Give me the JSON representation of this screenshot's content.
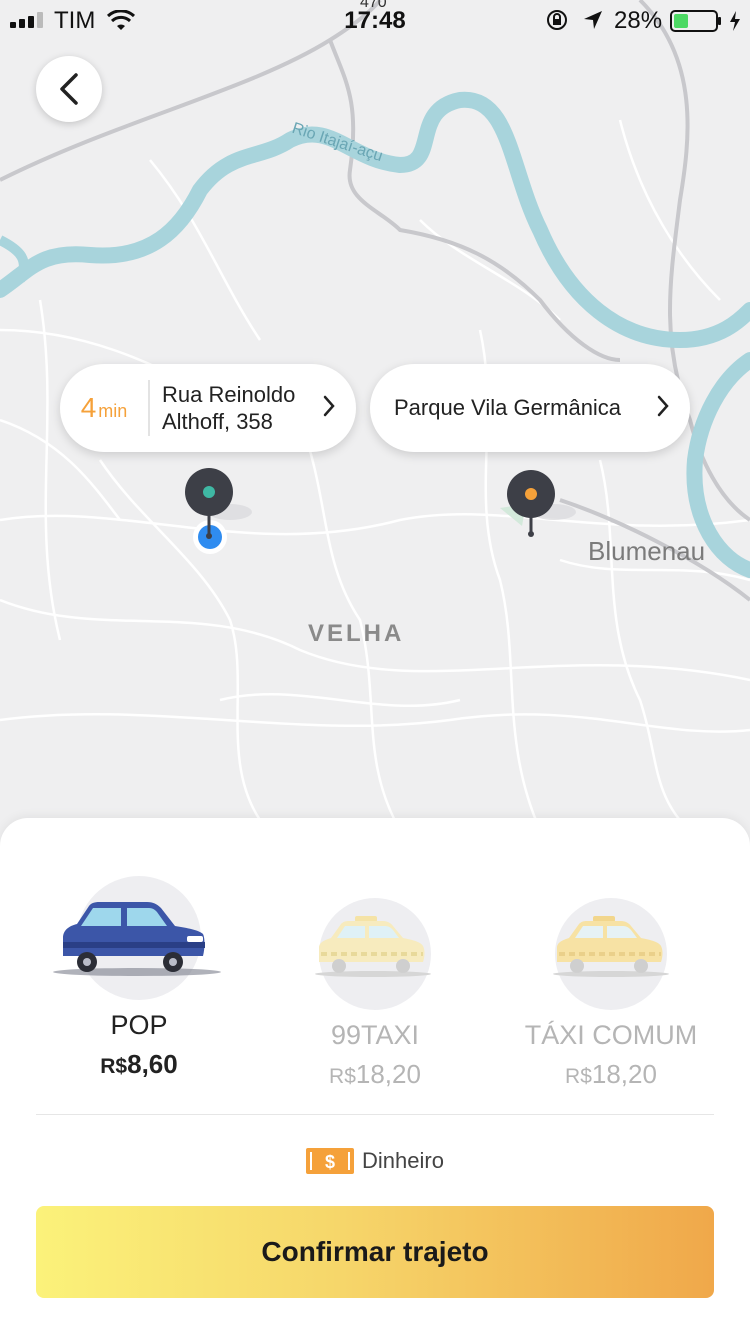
{
  "status_bar": {
    "carrier": "TIM",
    "time": "17:48",
    "battery": "28%",
    "route_code": "470"
  },
  "map": {
    "river_label": "Rio Itajaí-açu",
    "city_label": "Blumenau",
    "district_label": "VELHA"
  },
  "origin": {
    "eta_value": "4",
    "eta_unit": "min",
    "address_line1": "Rua Reinoldo",
    "address_line2": "Althoff, 358"
  },
  "destination": {
    "label": "Parque Vila Germânica"
  },
  "rides": [
    {
      "name": "POP",
      "currency": "R$",
      "price": "8,60",
      "selected": true
    },
    {
      "name": "99TAXI",
      "currency": "R$",
      "price": "18,20",
      "selected": false
    },
    {
      "name": "TÁXI COMUM",
      "currency": "R$",
      "price": "18,20",
      "selected": false
    }
  ],
  "payment": {
    "label": "Dinheiro",
    "icon": "cash-icon"
  },
  "confirm_label": "Confirmar trajeto",
  "colors": {
    "accent_orange": "#f5a13a",
    "origin_dot": "#3fb8a4",
    "user_location": "#2f8cf0",
    "river": "#a8d4dc"
  }
}
